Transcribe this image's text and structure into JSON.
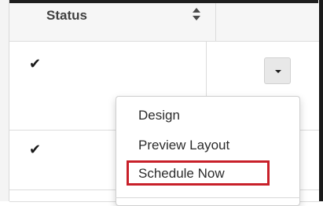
{
  "table": {
    "header": {
      "status_label": "Status",
      "sort_icon": "sort-icon"
    },
    "rows": [
      {
        "status_icon": "check-icon",
        "status_glyph": "✔"
      },
      {
        "status_icon": "check-icon",
        "status_glyph": "✔"
      }
    ]
  },
  "row_actions": {
    "dropdown_icon": "caret-down-icon"
  },
  "dropdown_menu": {
    "items": [
      {
        "label": "Design"
      },
      {
        "label": "Preview Layout"
      },
      {
        "label": "Schedule Now"
      }
    ],
    "highlighted_item": "Schedule Now",
    "highlight_color": "#c8202a"
  }
}
